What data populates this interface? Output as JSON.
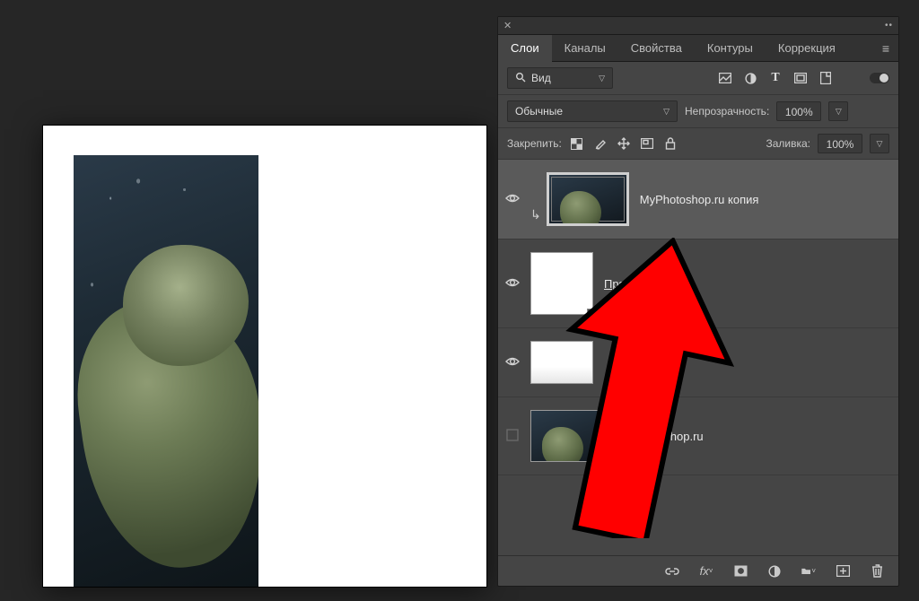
{
  "tabs": {
    "layers": "Слои",
    "channels": "Каналы",
    "properties": "Свойства",
    "paths": "Контуры",
    "adjustments": "Коррекция"
  },
  "filter": {
    "search_icon": "search-icon",
    "kind_label": "Вид"
  },
  "blend": {
    "mode": "Обычные",
    "opacity_label": "Непрозрачность:",
    "opacity_value": "100%"
  },
  "lock": {
    "label": "Закрепить:",
    "fill_label": "Заливка:",
    "fill_value": "100%"
  },
  "layers": [
    {
      "name": "MyPhotoshop.ru копия",
      "visible": true,
      "selected": true,
      "thumb": "hulk",
      "smart": true
    },
    {
      "name": "Прямоугольник",
      "visible": true,
      "selected": false,
      "thumb": "white-so",
      "underline": true
    },
    {
      "name": "",
      "visible": true,
      "selected": false,
      "thumb": "whitegrad-small"
    },
    {
      "name": "MyPhotoshop.ru",
      "visible": false,
      "selected": false,
      "thumb": "hulk-small"
    }
  ]
}
